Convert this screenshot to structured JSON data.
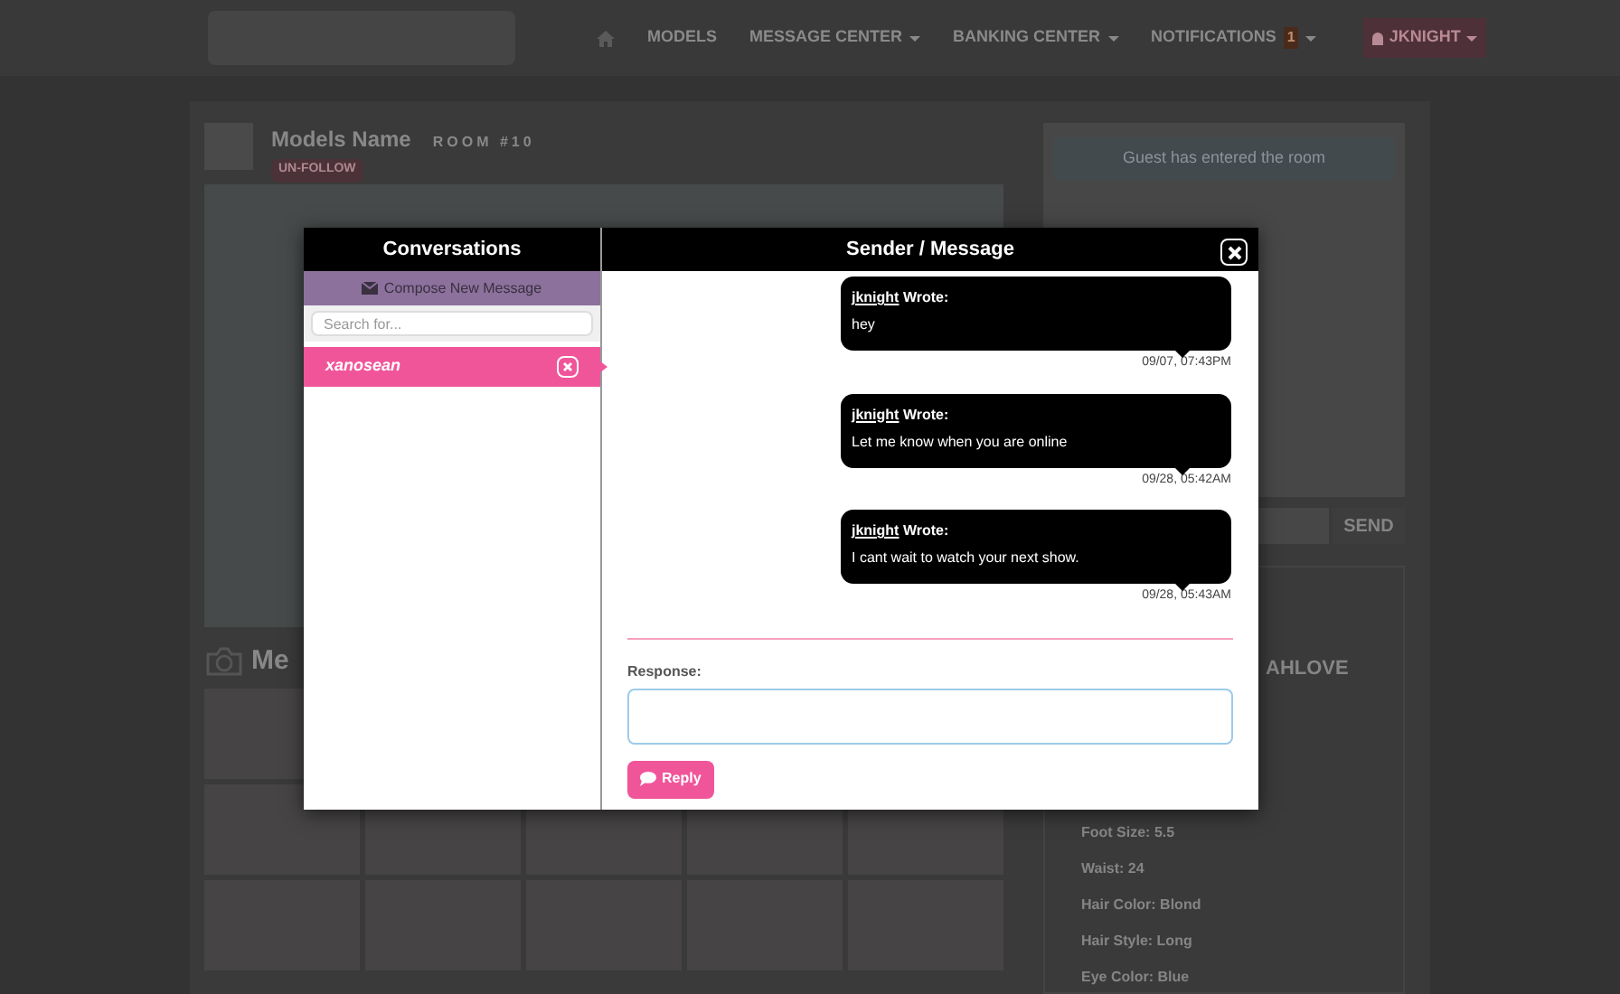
{
  "nav": {
    "items": [
      {
        "label": "MODELS"
      },
      {
        "label": "MESSAGE CENTER",
        "dropdown": true
      },
      {
        "label": "BANKING CENTER",
        "dropdown": true
      },
      {
        "label": "NOTIFICATIONS",
        "dropdown": true,
        "badge": "1"
      }
    ],
    "user_button": "JKNIGHT"
  },
  "profile": {
    "name": "Models Name",
    "room": "ROOM #10",
    "follow_button": "UN-FOLLOW"
  },
  "chat": {
    "system_message": "Guest has entered the room",
    "send_button": "SEND"
  },
  "media": {
    "title": "Me"
  },
  "details": {
    "title": "AHLOVE",
    "facts": [
      "Foot Size: 5.5",
      "Waist: 24",
      "Hair Color: Blond",
      "Hair Style: Long",
      "Eye Color: Blue"
    ]
  },
  "modal": {
    "conversations_title": "Conversations",
    "compose_button": "Compose New Message",
    "search_placeholder": "Search for...",
    "conversations": [
      {
        "name": "xanosean",
        "selected": true
      }
    ],
    "messages_title": "Sender / Message",
    "messages": [
      {
        "sender": "jknight",
        "wrote": "Wrote:",
        "text": "hey",
        "time": "09/07, 07:43PM"
      },
      {
        "sender": "jknight",
        "wrote": "Wrote:",
        "text": "Let me know when you are online",
        "time": "09/28, 05:42AM"
      },
      {
        "sender": "jknight",
        "wrote": "Wrote:",
        "text": "I cant wait to watch your next show.",
        "time": "09/28, 05:43AM"
      }
    ],
    "response_label": "Response:",
    "reply_button": "Reply"
  }
}
